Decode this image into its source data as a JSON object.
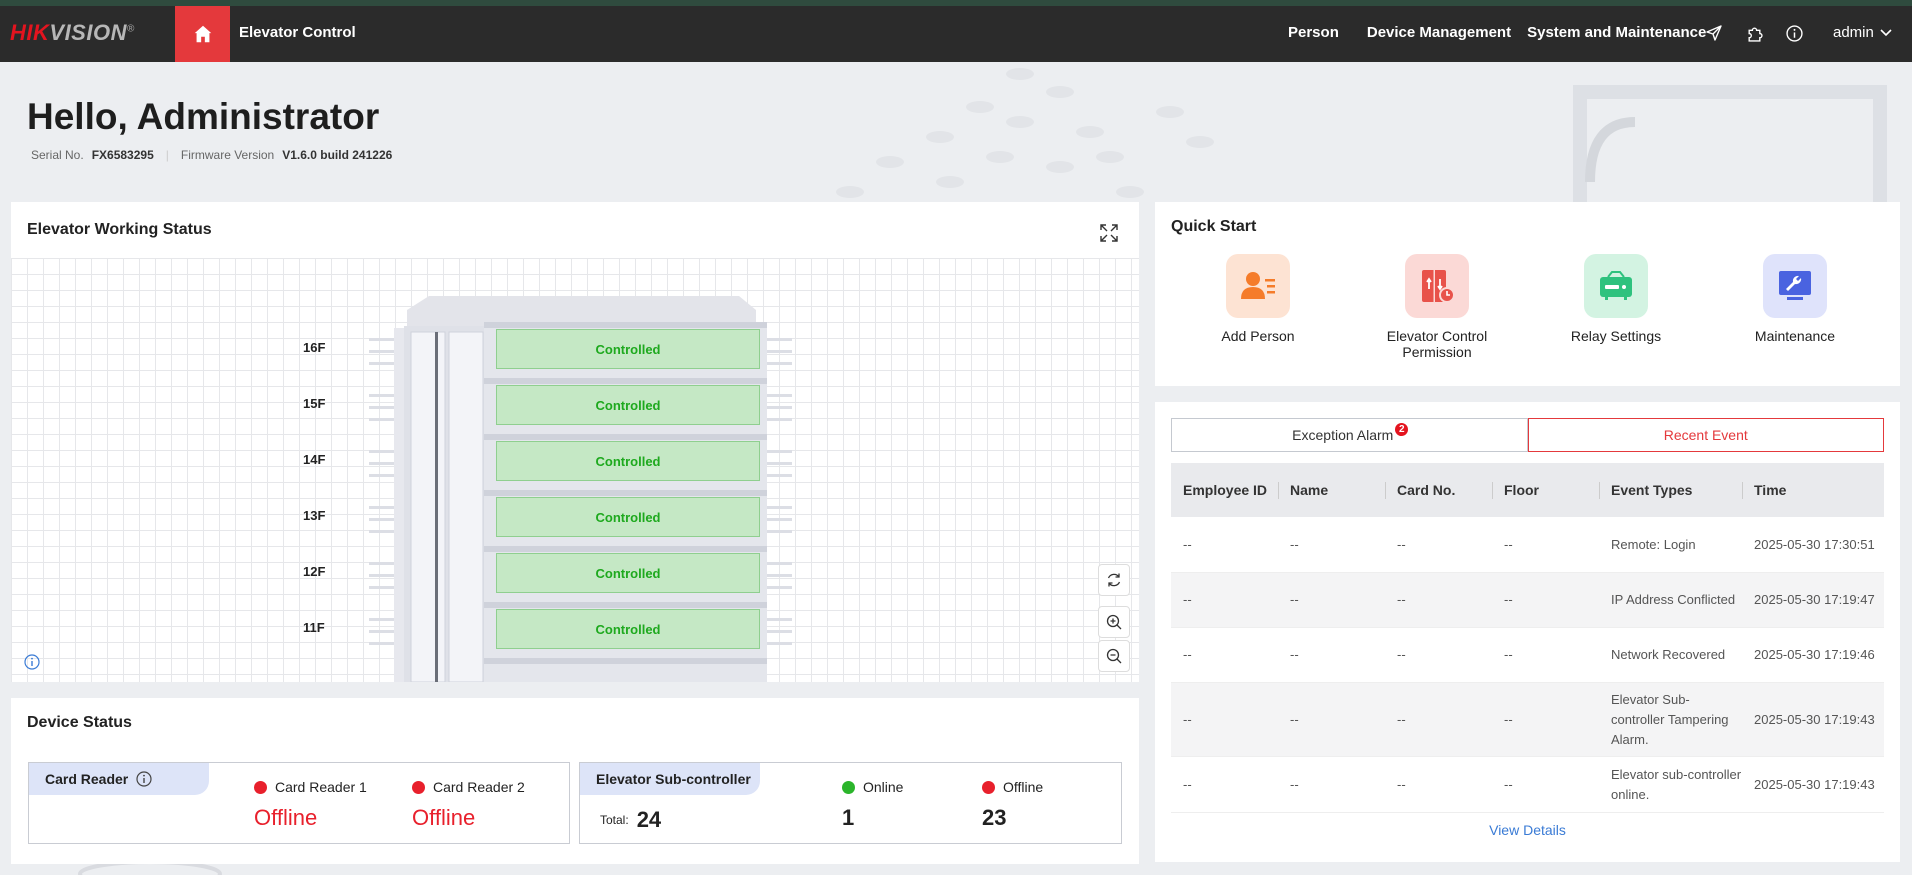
{
  "header": {
    "logo_brand": "HIKVISION",
    "app_title": "Elevator Control",
    "nav": [
      "Person",
      "Device Management",
      "System and Maintenance"
    ],
    "user": "admin",
    "icons": [
      "home-icon",
      "send-icon",
      "plugin-icon",
      "info-icon",
      "chevron-down-icon"
    ]
  },
  "greeting": {
    "title": "Hello, Administrator",
    "serial_label": "Serial No.",
    "serial_value": "FX6583295",
    "firmware_label": "Firmware Version",
    "firmware_value": "V1.6.0 build 241226"
  },
  "elevator_status": {
    "title": "Elevator Working Status",
    "floors": [
      {
        "label": "16F",
        "status": "Controlled"
      },
      {
        "label": "15F",
        "status": "Controlled"
      },
      {
        "label": "14F",
        "status": "Controlled"
      },
      {
        "label": "13F",
        "status": "Controlled"
      },
      {
        "label": "12F",
        "status": "Controlled"
      },
      {
        "label": "11F",
        "status": "Controlled"
      }
    ],
    "colors": {
      "controlled_bg": "#c5e8c5",
      "controlled_text": "#1ea91e"
    }
  },
  "device_status": {
    "title": "Device Status",
    "card_reader": {
      "label": "Card Reader",
      "items": [
        {
          "name": "Card Reader 1",
          "state": "Offline"
        },
        {
          "name": "Card Reader 2",
          "state": "Offline"
        }
      ]
    },
    "sub_controller": {
      "label": "Elevator Sub-controller",
      "total_label": "Total:",
      "total": "24",
      "online_label": "Online",
      "online": "1",
      "offline_label": "Offline",
      "offline": "23"
    }
  },
  "quick_start": {
    "title": "Quick Start",
    "items": [
      {
        "label": "Add Person",
        "icon": "add-person-icon",
        "color": "#f57c2a",
        "bg": "#fde3d3"
      },
      {
        "label": "Elevator Control Permission",
        "icon": "elevator-permission-icon",
        "color": "#e8524a",
        "bg": "#fbd9d6"
      },
      {
        "label": "Relay Settings",
        "icon": "relay-icon",
        "color": "#2ec27e",
        "bg": "#d3f3e2"
      },
      {
        "label": "Maintenance",
        "icon": "maintenance-icon",
        "color": "#4a63e0",
        "bg": "#dfe3fb"
      }
    ]
  },
  "events": {
    "tabs": [
      {
        "label": "Exception Alarm",
        "badge": "2"
      },
      {
        "label": "Recent Event"
      }
    ],
    "columns": [
      "Employee ID",
      "Name",
      "Card No.",
      "Floor",
      "Event Types",
      "Time"
    ],
    "rows": [
      [
        "--",
        "--",
        "--",
        "--",
        "Remote: Login",
        "2025-05-30 17:30:51"
      ],
      [
        "--",
        "--",
        "--",
        "--",
        "IP Address Conflicted",
        "2025-05-30 17:19:47"
      ],
      [
        "--",
        "--",
        "--",
        "--",
        "Network Recovered",
        "2025-05-30 17:19:46"
      ],
      [
        "--",
        "--",
        "--",
        "--",
        "Elevator Sub-controller Tampering Alarm.",
        "2025-05-30 17:19:43"
      ],
      [
        "--",
        "--",
        "--",
        "--",
        "Elevator sub-controller online.",
        "2025-05-30 17:19:43"
      ]
    ],
    "view_details": "View Details"
  }
}
